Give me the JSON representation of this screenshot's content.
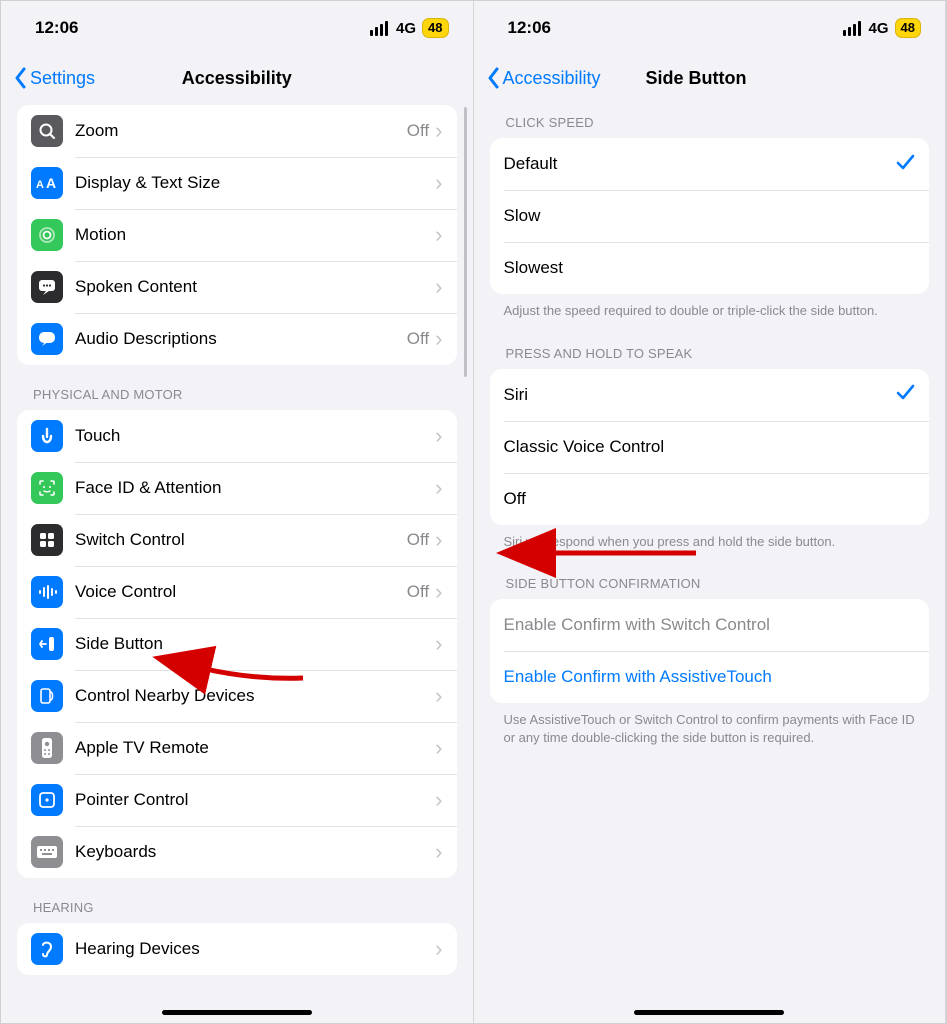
{
  "status": {
    "time": "12:06",
    "network": "4G",
    "battery": "48"
  },
  "left": {
    "back_label": "Settings",
    "title": "Accessibility",
    "list1": [
      {
        "id": "zoom",
        "label": "Zoom",
        "value": "Off",
        "icon": "zoom",
        "bg": "#5a5a5e"
      },
      {
        "id": "display-text",
        "label": "Display & Text Size",
        "value": "",
        "icon": "aa",
        "bg": "#007aff"
      },
      {
        "id": "motion",
        "label": "Motion",
        "value": "",
        "icon": "motion",
        "bg": "#34c759"
      },
      {
        "id": "spoken-content",
        "label": "Spoken Content",
        "value": "",
        "icon": "speech",
        "bg": "#2c2c2e"
      },
      {
        "id": "audio-desc",
        "label": "Audio Descriptions",
        "value": "Off",
        "icon": "bubble",
        "bg": "#007aff"
      }
    ],
    "section2_header": "PHYSICAL AND MOTOR",
    "list2": [
      {
        "id": "touch",
        "label": "Touch",
        "value": "",
        "icon": "touch",
        "bg": "#007aff"
      },
      {
        "id": "faceid",
        "label": "Face ID & Attention",
        "value": "",
        "icon": "face",
        "bg": "#34c759"
      },
      {
        "id": "switch-control",
        "label": "Switch Control",
        "value": "Off",
        "icon": "grid",
        "bg": "#2c2c2e"
      },
      {
        "id": "voice-control",
        "label": "Voice Control",
        "value": "Off",
        "icon": "voice",
        "bg": "#007aff"
      },
      {
        "id": "side-button",
        "label": "Side Button",
        "value": "",
        "icon": "sidebtn",
        "bg": "#007aff"
      },
      {
        "id": "nearby",
        "label": "Control Nearby Devices",
        "value": "",
        "icon": "nearby",
        "bg": "#007aff"
      },
      {
        "id": "appletv",
        "label": "Apple TV Remote",
        "value": "",
        "icon": "remote",
        "bg": "#8e8e93"
      },
      {
        "id": "pointer",
        "label": "Pointer Control",
        "value": "",
        "icon": "pointer",
        "bg": "#007aff"
      },
      {
        "id": "keyboards",
        "label": "Keyboards",
        "value": "",
        "icon": "keyboard",
        "bg": "#8e8e93"
      }
    ],
    "section3_header": "HEARING",
    "list3": [
      {
        "id": "hearing-devices",
        "label": "Hearing Devices",
        "value": "",
        "icon": "ear",
        "bg": "#007aff"
      }
    ]
  },
  "right": {
    "back_label": "Accessibility",
    "title": "Side Button",
    "section1_header": "CLICK SPEED",
    "speed": [
      {
        "id": "default",
        "label": "Default",
        "checked": true
      },
      {
        "id": "slow",
        "label": "Slow",
        "checked": false
      },
      {
        "id": "slowest",
        "label": "Slowest",
        "checked": false
      }
    ],
    "section1_footer": "Adjust the speed required to double or triple-click the side button.",
    "section2_header": "PRESS AND HOLD TO SPEAK",
    "hold": [
      {
        "id": "siri",
        "label": "Siri",
        "checked": true
      },
      {
        "id": "classic",
        "label": "Classic Voice Control",
        "checked": false
      },
      {
        "id": "off",
        "label": "Off",
        "checked": false
      }
    ],
    "section2_footer": "Siri will respond when you press and hold the side button.",
    "section3_header": "SIDE BUTTON CONFIRMATION",
    "confirm": [
      {
        "id": "switch",
        "label": "Enable Confirm with Switch Control",
        "style": "disabled"
      },
      {
        "id": "assist",
        "label": "Enable Confirm with AssistiveTouch",
        "style": "link"
      }
    ],
    "section3_footer": "Use AssistiveTouch or Switch Control to confirm payments with Face ID or any time double-clicking the side button is required."
  }
}
